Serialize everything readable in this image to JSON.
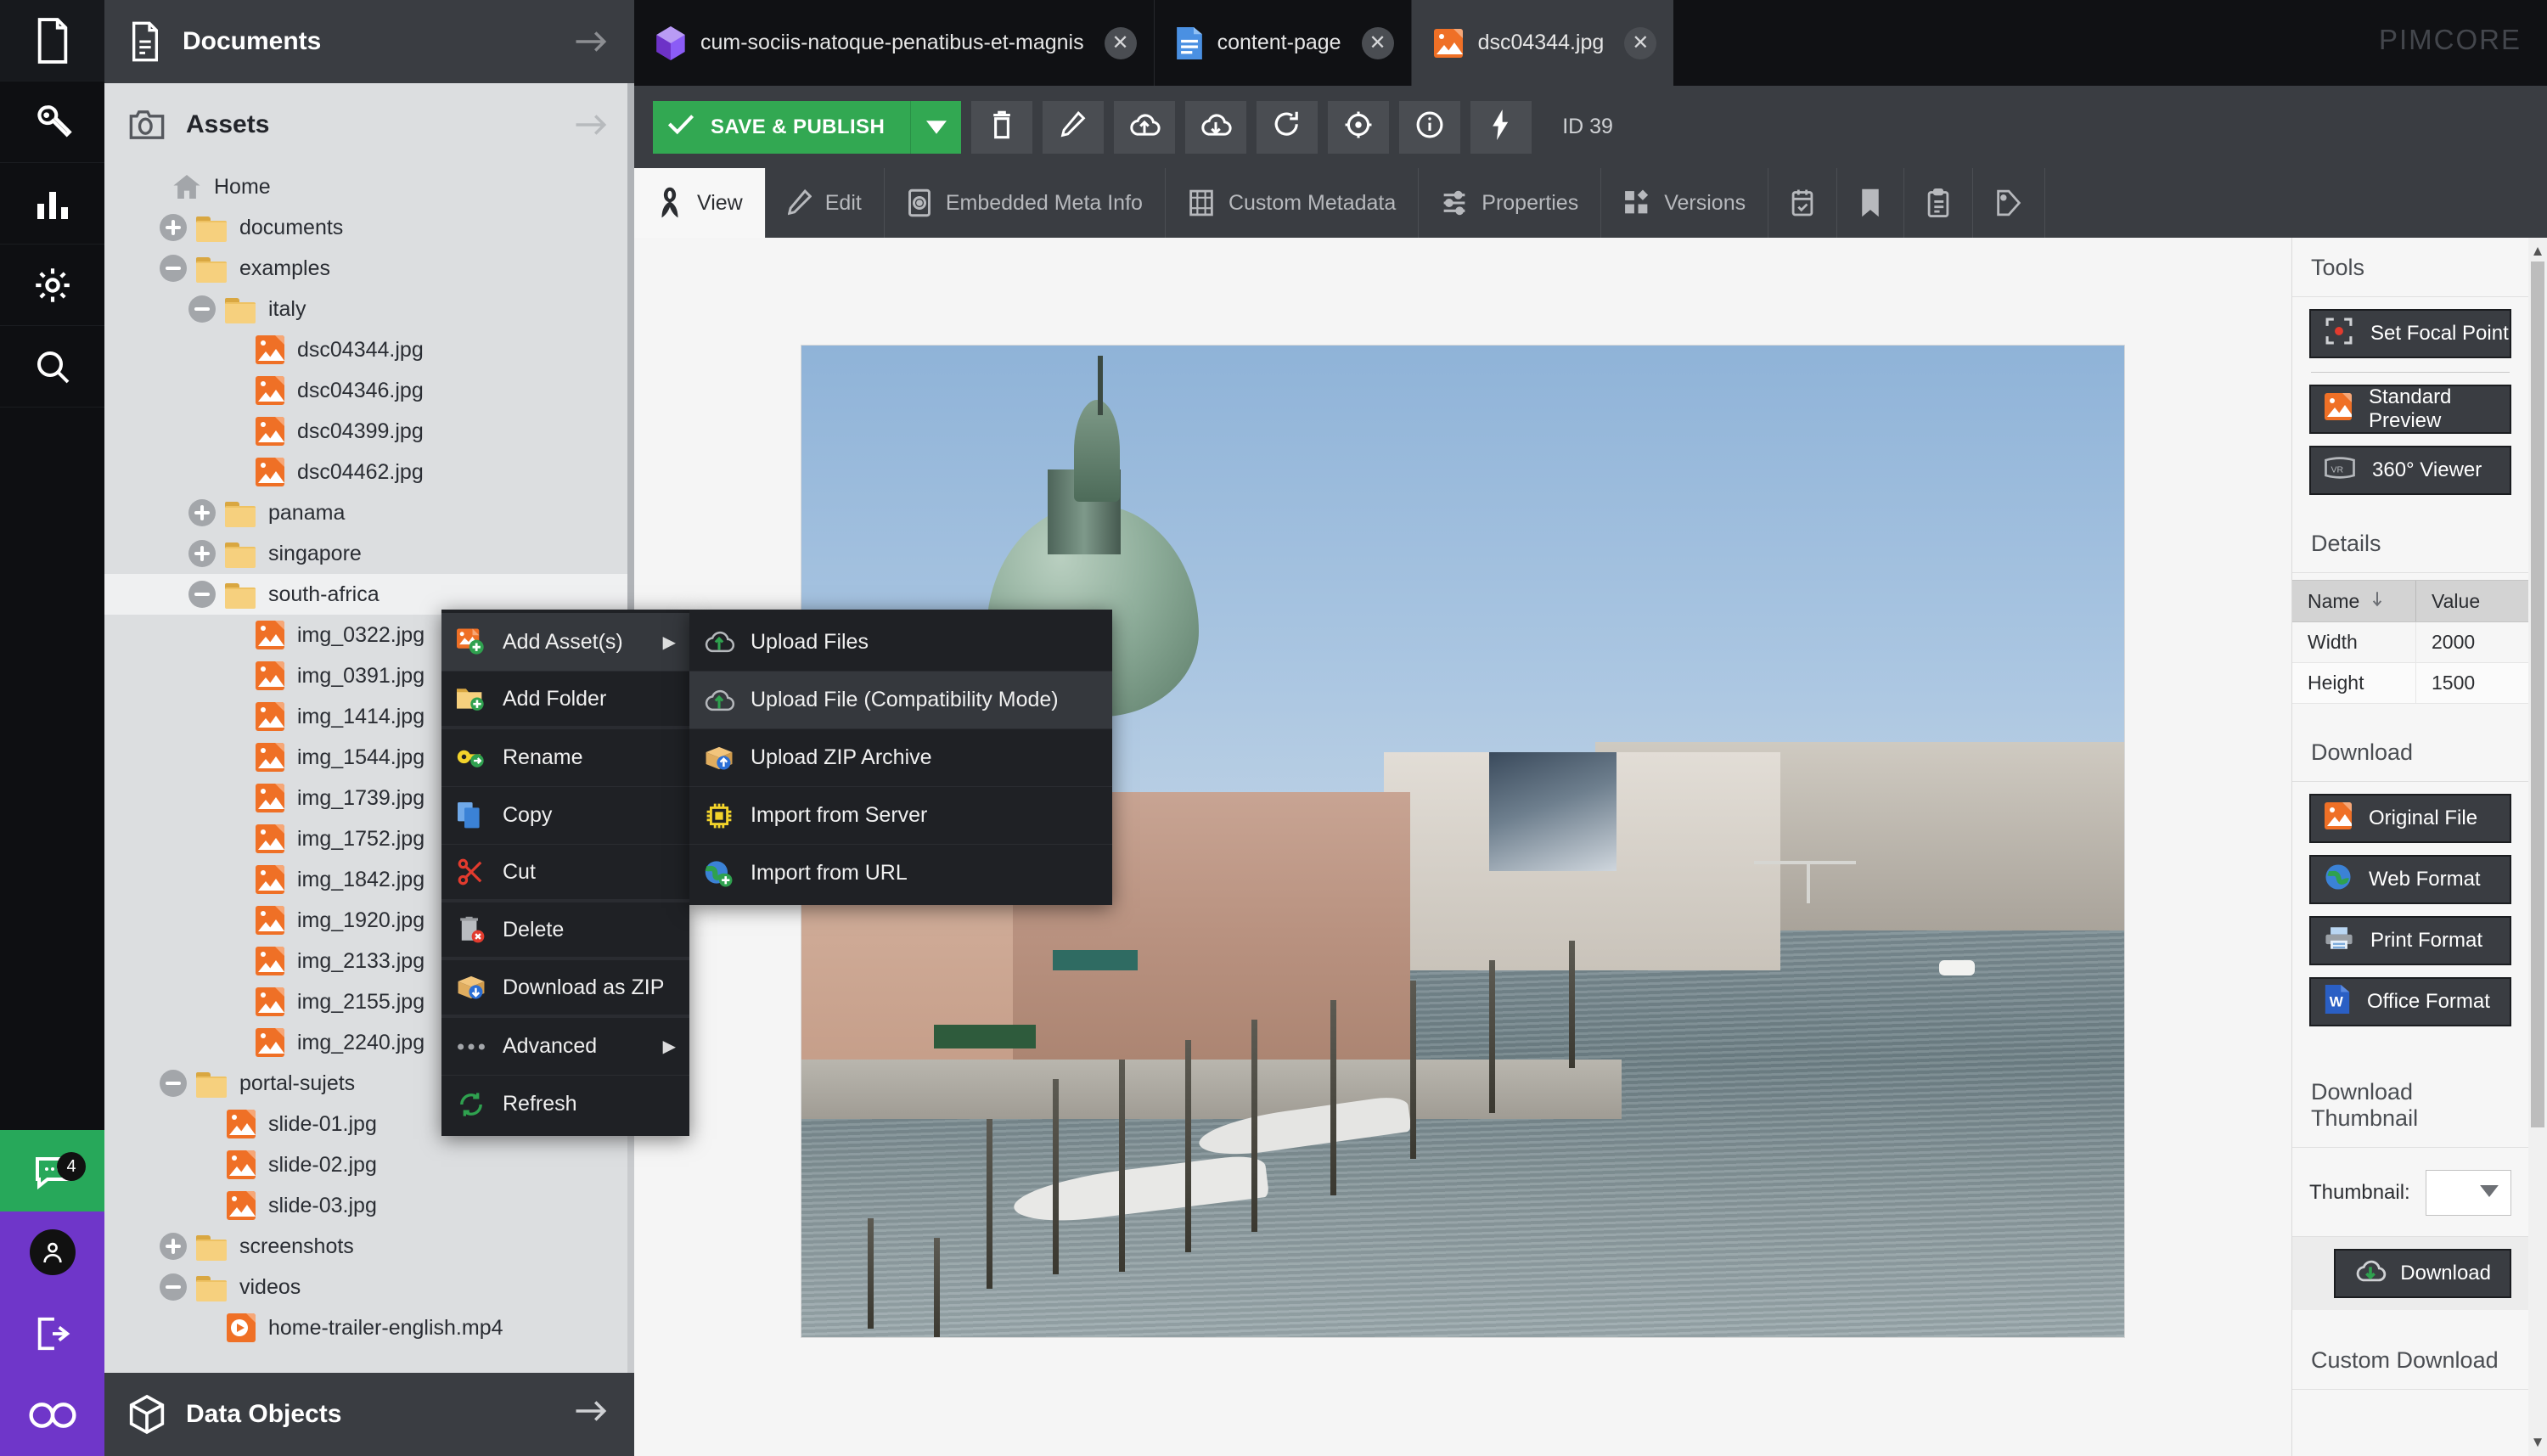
{
  "app": {
    "brand": "PIMCORE"
  },
  "rail": {
    "items": [
      {
        "name": "documents",
        "icon": "document-icon"
      },
      {
        "name": "tools",
        "icon": "wrench-icon"
      },
      {
        "name": "reports",
        "icon": "bar-chart-icon"
      },
      {
        "name": "settings",
        "icon": "gear-icon"
      },
      {
        "name": "search",
        "icon": "magnifier-icon"
      }
    ],
    "notifications": {
      "icon": "chat-icon",
      "badge": "4"
    },
    "account": {
      "icon": "user-icon"
    },
    "logout": {
      "icon": "logout-icon"
    },
    "infinity": {
      "icon": "infinity-icon"
    }
  },
  "sidebar": {
    "documents_header": "Documents",
    "assets_header": "Assets",
    "data_objects_footer": "Data Objects",
    "tree": [
      {
        "label": "Home",
        "type": "home",
        "depth": 0,
        "toggle": "none",
        "selected": false
      },
      {
        "label": "documents",
        "type": "folder",
        "depth": 1,
        "toggle": "plus",
        "selected": false
      },
      {
        "label": "examples",
        "type": "folder",
        "depth": 1,
        "toggle": "minus",
        "selected": false
      },
      {
        "label": "italy",
        "type": "folder",
        "depth": 2,
        "toggle": "minus",
        "selected": false
      },
      {
        "label": "dsc04344.jpg",
        "type": "image",
        "depth": 3,
        "toggle": "none",
        "selected": false
      },
      {
        "label": "dsc04346.jpg",
        "type": "image",
        "depth": 3,
        "toggle": "none",
        "selected": false
      },
      {
        "label": "dsc04399.jpg",
        "type": "image",
        "depth": 3,
        "toggle": "none",
        "selected": false
      },
      {
        "label": "dsc04462.jpg",
        "type": "image",
        "depth": 3,
        "toggle": "none",
        "selected": false
      },
      {
        "label": "panama",
        "type": "folder",
        "depth": 2,
        "toggle": "plus",
        "selected": false
      },
      {
        "label": "singapore",
        "type": "folder",
        "depth": 2,
        "toggle": "plus",
        "selected": false
      },
      {
        "label": "south-africa",
        "type": "folder",
        "depth": 2,
        "toggle": "minus",
        "selected": true
      },
      {
        "label": "img_0322.jpg",
        "type": "image",
        "depth": 3,
        "toggle": "none",
        "selected": false
      },
      {
        "label": "img_0391.jpg",
        "type": "image",
        "depth": 3,
        "toggle": "none",
        "selected": false
      },
      {
        "label": "img_1414.jpg",
        "type": "image",
        "depth": 3,
        "toggle": "none",
        "selected": false
      },
      {
        "label": "img_1544.jpg",
        "type": "image",
        "depth": 3,
        "toggle": "none",
        "selected": false
      },
      {
        "label": "img_1739.jpg",
        "type": "image",
        "depth": 3,
        "toggle": "none",
        "selected": false
      },
      {
        "label": "img_1752.jpg",
        "type": "image",
        "depth": 3,
        "toggle": "none",
        "selected": false
      },
      {
        "label": "img_1842.jpg",
        "type": "image",
        "depth": 3,
        "toggle": "none",
        "selected": false
      },
      {
        "label": "img_1920.jpg",
        "type": "image",
        "depth": 3,
        "toggle": "none",
        "selected": false
      },
      {
        "label": "img_2133.jpg",
        "type": "image",
        "depth": 3,
        "toggle": "none",
        "selected": false
      },
      {
        "label": "img_2155.jpg",
        "type": "image",
        "depth": 3,
        "toggle": "none",
        "selected": false
      },
      {
        "label": "img_2240.jpg",
        "type": "image",
        "depth": 3,
        "toggle": "none",
        "selected": false
      },
      {
        "label": "portal-sujets",
        "type": "folder",
        "depth": 1,
        "toggle": "minus",
        "selected": false
      },
      {
        "label": "slide-01.jpg",
        "type": "image",
        "depth": 2,
        "toggle": "none",
        "selected": false
      },
      {
        "label": "slide-02.jpg",
        "type": "image",
        "depth": 2,
        "toggle": "none",
        "selected": false
      },
      {
        "label": "slide-03.jpg",
        "type": "image",
        "depth": 2,
        "toggle": "none",
        "selected": false
      },
      {
        "label": "screenshots",
        "type": "folder",
        "depth": 1,
        "toggle": "plus",
        "selected": false
      },
      {
        "label": "videos",
        "type": "folder",
        "depth": 1,
        "toggle": "minus",
        "selected": false
      },
      {
        "label": "home-trailer-english.mp4",
        "type": "video",
        "depth": 2,
        "toggle": "none",
        "selected": false
      }
    ]
  },
  "doc_tabs": [
    {
      "label": "cum-sociis-natoque-penatibus-et-magnis",
      "icon": "object-icon",
      "active": false
    },
    {
      "label": "content-page",
      "icon": "page-icon",
      "active": false
    },
    {
      "label": "dsc04344.jpg",
      "icon": "image-icon",
      "active": true
    }
  ],
  "toolbar": {
    "save_label": "SAVE & PUBLISH",
    "id_label": "ID 39",
    "buttons": [
      {
        "name": "delete-button",
        "icon": "trash-icon"
      },
      {
        "name": "edit-button",
        "icon": "pencil-icon"
      },
      {
        "name": "upload-button",
        "icon": "cloud-upload-icon"
      },
      {
        "name": "download-button",
        "icon": "cloud-download-icon"
      },
      {
        "name": "reload-button",
        "icon": "reload-icon"
      },
      {
        "name": "target-button",
        "icon": "target-icon"
      },
      {
        "name": "info-button",
        "icon": "info-icon"
      },
      {
        "name": "workflow-button",
        "icon": "lightning-icon"
      }
    ]
  },
  "sub_tabs": [
    {
      "label": "View",
      "icon": "view-icon",
      "active": true
    },
    {
      "label": "Edit",
      "icon": "pencil-icon",
      "active": false
    },
    {
      "label": "Embedded Meta Info",
      "icon": "camera-meta-icon",
      "active": false
    },
    {
      "label": "Custom Metadata",
      "icon": "metadata-icon",
      "active": false
    },
    {
      "label": "Properties",
      "icon": "sliders-icon",
      "active": false
    },
    {
      "label": "Versions",
      "icon": "versions-icon",
      "active": false
    },
    {
      "label": "",
      "icon": "schedule-icon",
      "active": false
    },
    {
      "label": "",
      "icon": "bookmark-icon",
      "active": false
    },
    {
      "label": "",
      "icon": "notes-icon",
      "active": false
    },
    {
      "label": "",
      "icon": "tag-icon",
      "active": false
    }
  ],
  "tools_panel": {
    "tools_title": "Tools",
    "tools": [
      {
        "label": "Set Focal Point",
        "icon": "focal-point-icon"
      },
      {
        "label": "Standard Preview",
        "icon": "image-icon"
      },
      {
        "label": "360° Viewer",
        "icon": "vr-icon"
      }
    ],
    "details_title": "Details",
    "details_headers": {
      "name": "Name",
      "value": "Value"
    },
    "details_rows": [
      {
        "name": "Width",
        "value": "2000"
      },
      {
        "name": "Height",
        "value": "1500"
      }
    ],
    "download_title": "Download",
    "download_buttons": [
      {
        "label": "Original File",
        "icon": "image-icon"
      },
      {
        "label": "Web Format",
        "icon": "globe-icon"
      },
      {
        "label": "Print Format",
        "icon": "printer-icon"
      },
      {
        "label": "Office Format",
        "icon": "word-icon"
      }
    ],
    "download_thumbnail_title": "Download Thumbnail",
    "thumbnail_label": "Thumbnail:",
    "thumbnail_value": "",
    "download_button_label": "Download",
    "custom_download_title": "Custom Download"
  },
  "context_menu": {
    "items": [
      {
        "label": "Add Asset(s)",
        "icon": "add-asset-icon",
        "submenu": true,
        "highlight": true,
        "sep_after": false
      },
      {
        "label": "Add Folder",
        "icon": "add-folder-icon",
        "submenu": false,
        "highlight": false,
        "sep_after": true
      },
      {
        "label": "Rename",
        "icon": "rename-key-icon",
        "submenu": false,
        "highlight": false,
        "sep_after": false
      },
      {
        "label": "Copy",
        "icon": "copy-icon",
        "submenu": false,
        "highlight": false,
        "sep_after": false
      },
      {
        "label": "Cut",
        "icon": "cut-scissors-icon",
        "submenu": false,
        "highlight": false,
        "sep_after": true
      },
      {
        "label": "Delete",
        "icon": "delete-trash-icon",
        "submenu": false,
        "highlight": false,
        "sep_after": true
      },
      {
        "label": "Download as ZIP",
        "icon": "zip-download-icon",
        "submenu": false,
        "highlight": false,
        "sep_after": true
      },
      {
        "label": "Advanced",
        "icon": "ellipsis-icon",
        "submenu": true,
        "highlight": false,
        "sep_after": false
      },
      {
        "label": "Refresh",
        "icon": "refresh-icon",
        "submenu": false,
        "highlight": false,
        "sep_after": false
      }
    ],
    "submenu_items": [
      {
        "label": "Upload Files",
        "icon": "cloud-upload-icon",
        "highlight": false
      },
      {
        "label": "Upload File (Compatibility Mode)",
        "icon": "cloud-upload-icon",
        "highlight": true
      },
      {
        "label": "Upload ZIP Archive",
        "icon": "zip-upload-icon",
        "highlight": false
      },
      {
        "label": "Import from Server",
        "icon": "chip-icon",
        "highlight": false
      },
      {
        "label": "Import from URL",
        "icon": "globe-add-icon",
        "highlight": false
      }
    ]
  },
  "colors": {
    "accent_green": "#32a852",
    "asset_orange": "#ef7026",
    "dark_chrome": "#3a3d42",
    "darker_chrome": "#101114",
    "notification_green": "#27a85a",
    "account_purple": "#6f36c9"
  }
}
